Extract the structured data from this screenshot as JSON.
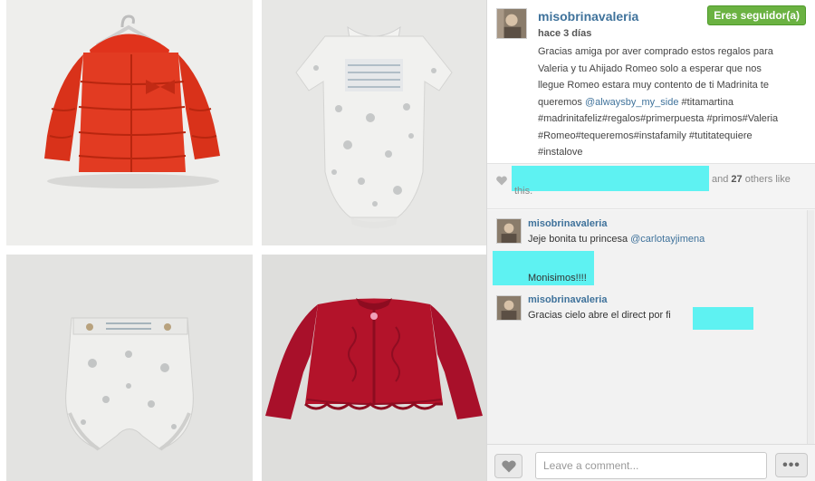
{
  "post": {
    "username": "misobrinavaleria",
    "follow_label": "Eres seguidor(a)",
    "timestamp": "hace 3 días",
    "caption_lines": [
      "Gracias amiga por aver comprado estos regalos para",
      "Valeria y tu Ahijado Romeo solo a esperar que nos",
      "llegue Romeo estara muy contento de ti Madrinita te",
      "#madrinitafeliz#regalos#primerpuesta #primos#Valeria",
      "#Romeo#tequeremos#instafamily #tutitatequiere",
      "#instalove"
    ],
    "caption_line4_prefix": "queremos ",
    "caption_mention": "@alwaysby_my_side",
    "caption_line4_suffix": " #titamartina"
  },
  "likes": {
    "and_label": "and",
    "count": "27",
    "others_label": "others like",
    "tail": "this."
  },
  "comments": [
    {
      "user": "misobrinavaleria",
      "text_prefix": "Jeje bonita tu princesa ",
      "mention": "@carlotayjimena"
    },
    {
      "user": "",
      "text": "Monisimos!!!!"
    },
    {
      "user": "misobrinavaleria",
      "text": "Gracias cielo abre el direct por fi"
    }
  ],
  "footer": {
    "comment_placeholder": "Leave a comment...",
    "more_label": "•••"
  },
  "photos": [
    {
      "item": "red-puffer-coat-photo"
    },
    {
      "item": "white-smocked-romper-photo"
    },
    {
      "item": "white-bloomers-photo"
    },
    {
      "item": "red-knit-cardigan-photo"
    }
  ],
  "colors": {
    "username_blue": "#3f729b",
    "follow_green": "#6bb242",
    "redaction_cyan": "#5ef2f2"
  }
}
